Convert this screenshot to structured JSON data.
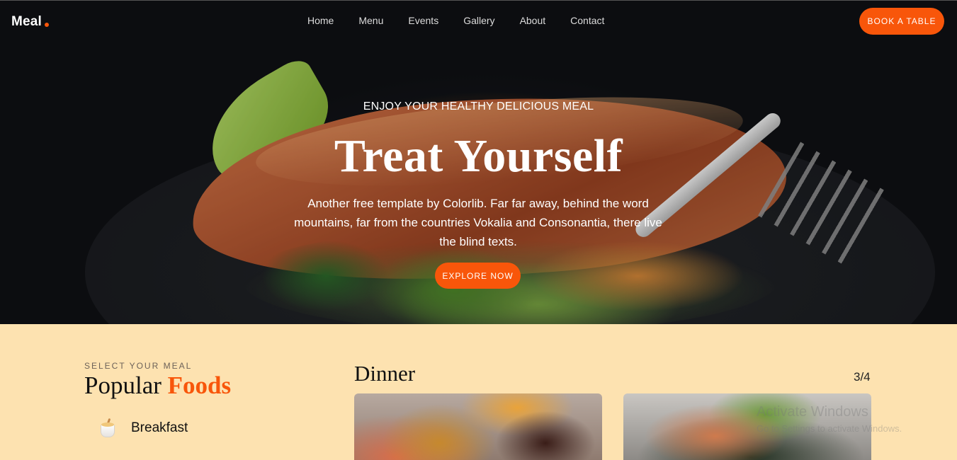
{
  "brand": {
    "logo": "Meal"
  },
  "nav": {
    "items": [
      "Home",
      "Menu",
      "Events",
      "Gallery",
      "About",
      "Contact"
    ],
    "cta": "BOOK A TABLE"
  },
  "hero": {
    "subtitle": "ENJOY YOUR HEALTHY DELICIOUS MEAL",
    "title": "Treat Yourself",
    "description": "Another free template by Colorlib. Far far away, behind the word mountains, far from the countries Vokalia and Consonantia, there live the blind texts.",
    "cta": "EXPLORE NOW"
  },
  "section": {
    "eyebrow": "SELECT YOUR MEAL",
    "title_part1": "Popular",
    "title_accent": "Foods",
    "categories": [
      {
        "label": "Breakfast",
        "icon": "coffee-cup-icon"
      }
    ],
    "menu_title": "Dinner",
    "pager": "3/4"
  },
  "watermark": {
    "line1": "Activate Windows",
    "line2": "Go to Settings to activate Windows."
  },
  "colors": {
    "accent": "#f8560a",
    "section_bg": "#fde2b0"
  }
}
